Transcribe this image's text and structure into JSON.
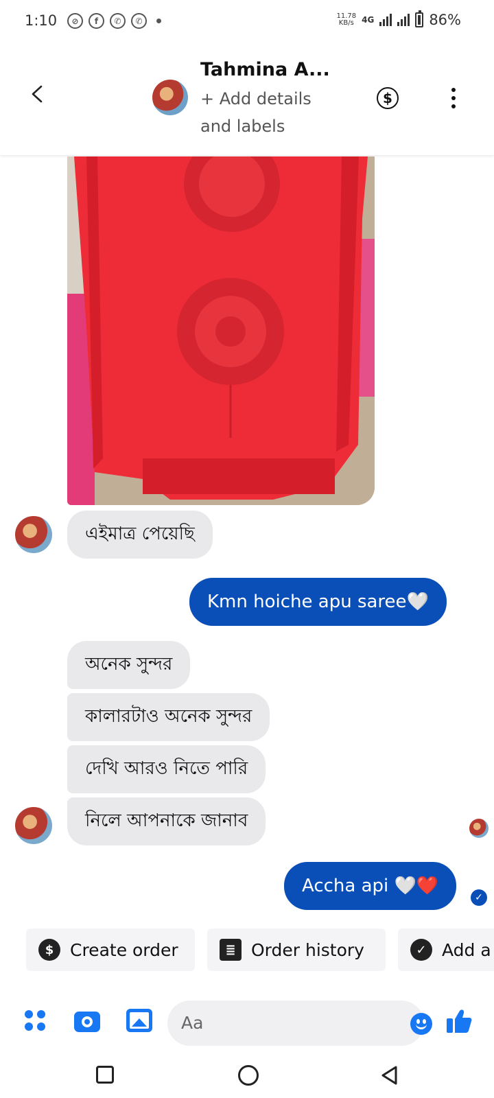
{
  "status_bar": {
    "time": "1:10",
    "speed_value": "11.78",
    "speed_unit": "KB/s",
    "network": "4G",
    "battery": "86%"
  },
  "header": {
    "contact_name": "Tahmina A...",
    "details_link": "+ Add details and labels",
    "payment_icon": "$"
  },
  "messages": [
    {
      "type": "image",
      "from": "them",
      "description_icon": "photo"
    },
    {
      "from": "them",
      "text": "এইমাত্র পেয়েছি"
    },
    {
      "from": "me",
      "text": "Kmn hoiche apu saree🤍"
    },
    {
      "from": "them",
      "text": "অনেক সুন্দর"
    },
    {
      "from": "them",
      "text": "কালারটাও অনেক সুন্দর"
    },
    {
      "from": "them",
      "text": "দেখি আরও নিতে পারি"
    },
    {
      "from": "them",
      "text": "নিলে আপনাকে জানাব"
    },
    {
      "from": "me",
      "text": "Accha api 🤍❤️"
    }
  ],
  "quick_actions": [
    {
      "label": "Create order",
      "icon": "$"
    },
    {
      "label": "Order history",
      "icon": "≣"
    },
    {
      "label": "Add a",
      "icon": "✓"
    }
  ],
  "composer": {
    "placeholder": "Aa"
  },
  "colors": {
    "accent": "#1877f2",
    "outgoing_bubble": "#0a4fb8",
    "incoming_bubble": "#e9e9eb"
  }
}
